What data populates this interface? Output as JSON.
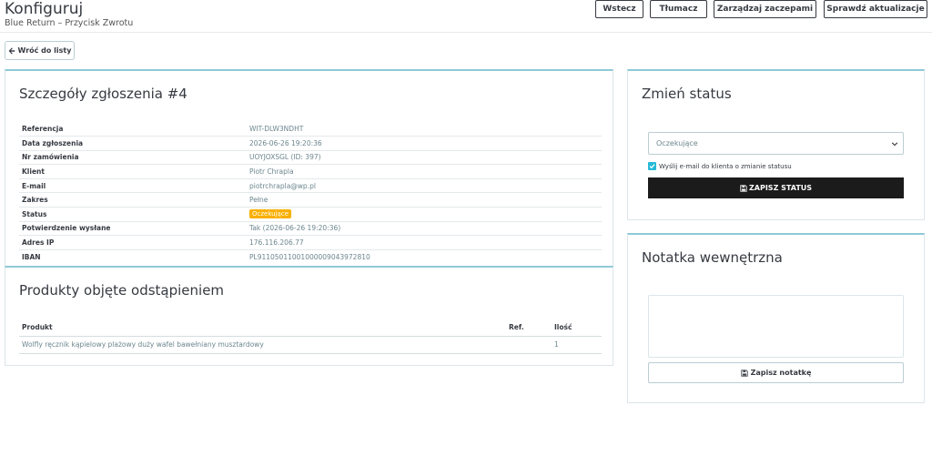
{
  "header": {
    "title": "Konfiguruj",
    "subtitle": "Blue Return – Przycisk Zwrotu",
    "buttons": {
      "back": "Wstecz",
      "translate": "Tłumacz",
      "hooks": "Zarządzaj zaczepami",
      "updates": "Sprawdź aktualizacje"
    }
  },
  "back_to_list": "Wróć do listy",
  "details": {
    "title": "Szczegóły zgłoszenia #4",
    "rows": [
      {
        "label": "Referencja",
        "value": "WIT-DLW3NDHT"
      },
      {
        "label": "Data zgłoszenia",
        "value": "2026-06-26 19:20:36"
      },
      {
        "label": "Nr zamówienia",
        "value": "UOYJOXSGL (ID: 397)"
      },
      {
        "label": "Klient",
        "value": "Piotr Chrapla"
      },
      {
        "label": "E-mail",
        "value": "piotrchrapla@wp.pl"
      },
      {
        "label": "Zakres",
        "value": "Pełne"
      },
      {
        "label": "Status",
        "value": "Oczekujące",
        "badge": true
      },
      {
        "label": "Potwierdzenie wysłane",
        "value": "Tak (2026-06-26 19:20:36)"
      },
      {
        "label": "Adres IP",
        "value": "176.116.206.77"
      },
      {
        "label": "IBAN",
        "value": "PL91105011001000009043972810"
      }
    ]
  },
  "products": {
    "title": "Produkty objęte odstąpieniem",
    "columns": {
      "product": "Produkt",
      "ref": "Ref.",
      "qty": "Ilość"
    },
    "rows": [
      {
        "product": "Wolfly ręcznik kąpielowy plażowy duży wafel bawełniany musztardowy",
        "ref": "",
        "qty": "1"
      }
    ]
  },
  "status_card": {
    "title": "Zmień status",
    "selected": "Oczekujące",
    "email_checkbox": "Wyślij e-mail do klienta o zmianie statusu",
    "save_button": "ZAPISZ STATUS"
  },
  "note_card": {
    "title": "Notatka wewnętrzna",
    "save_button": "Zapisz notatkę"
  },
  "colors": {
    "accent": "#25b9d7",
    "badge": "#fab000",
    "card_border_top": "#8fc9d7",
    "dark_button": "#1b1b1b"
  },
  "icons": [
    "arrow-left-icon",
    "save-icon",
    "chevron-down-icon",
    "check-icon"
  ]
}
